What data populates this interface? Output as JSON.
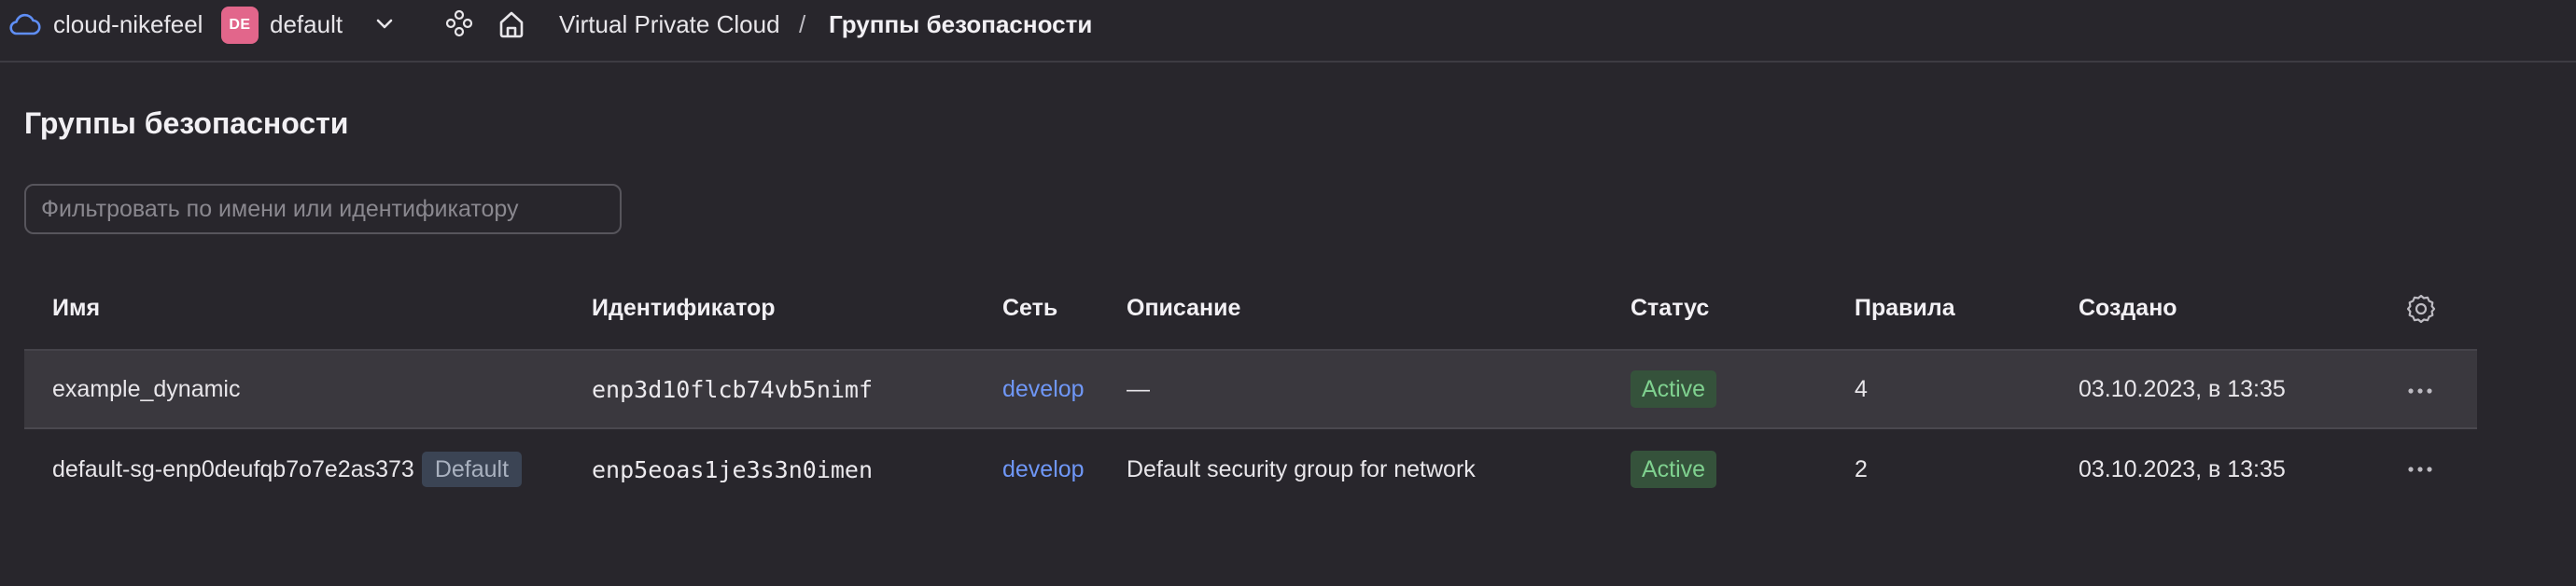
{
  "header": {
    "cloud_name": "cloud-nikefeel",
    "folder_badge": "DE",
    "folder_name": "default",
    "breadcrumb": {
      "service": "Virtual Private Cloud",
      "separator": "/",
      "current": "Группы безопасности"
    },
    "icons": [
      "cloud-icon",
      "chevron-down-icon",
      "services-icon",
      "home-icon"
    ]
  },
  "page": {
    "title": "Группы безопасности",
    "filter": {
      "placeholder": "Фильтровать по имени или идентификатору",
      "value": ""
    }
  },
  "table": {
    "columns": [
      "Имя",
      "Идентификатор",
      "Сеть",
      "Описание",
      "Статус",
      "Правила",
      "Создано"
    ],
    "rows": [
      {
        "name": "example_dynamic",
        "tag": "",
        "id": "enp3d10flcb74vb5nimf",
        "network": "develop",
        "description": "—",
        "status": "Active",
        "rules": "4",
        "created": "03.10.2023, в 13:35"
      },
      {
        "name": "default-sg-enp0deufqb7o7e2as373",
        "tag": "Default",
        "id": "enp5eoas1je3s3n0imen",
        "network": "develop",
        "description": "Default security group for network",
        "status": "Active",
        "rules": "2",
        "created": "03.10.2023, в 13:35"
      }
    ]
  },
  "colors": {
    "background": "#28262c",
    "accent_link": "#6f97f7",
    "status_active_bg": "#35523b",
    "status_active_text": "#7fd18f",
    "folder_badge": "#e2668b",
    "cloud_icon": "#5f8ef5"
  }
}
